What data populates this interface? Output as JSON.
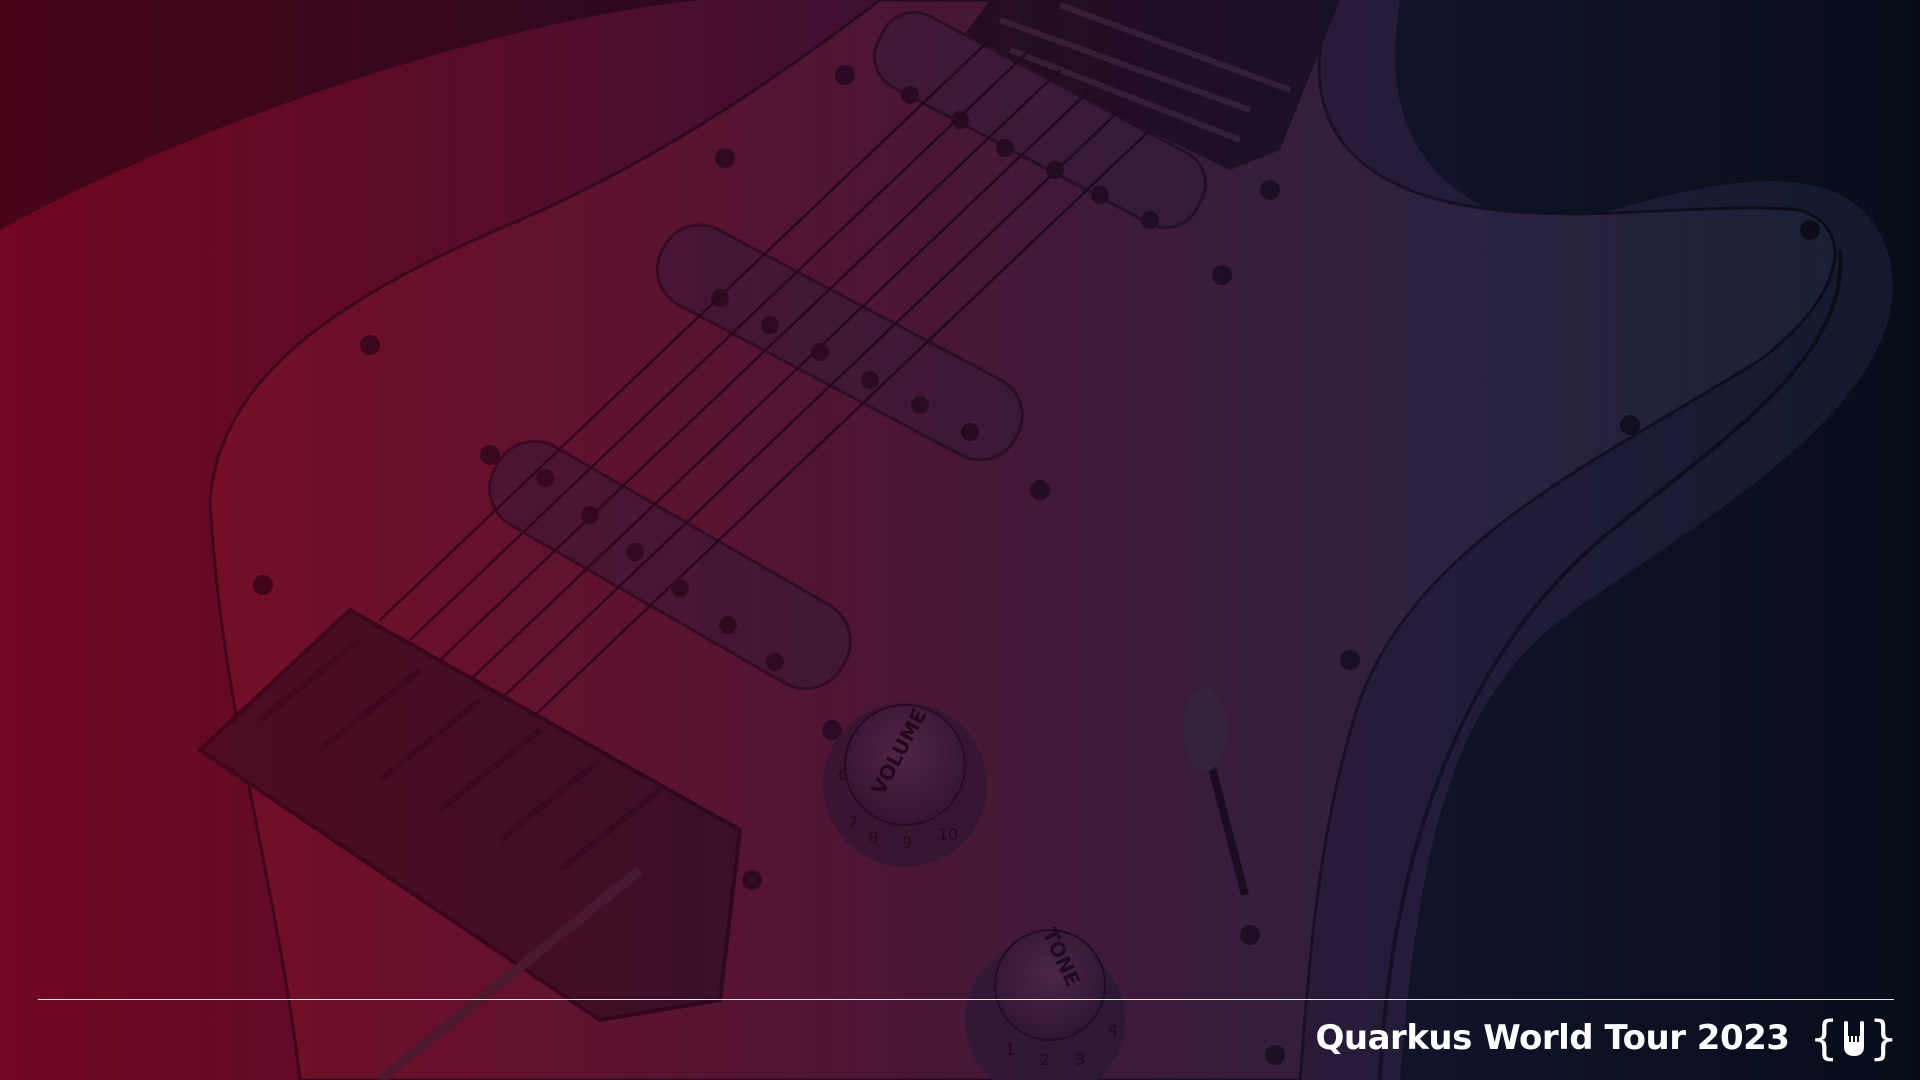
{
  "background": {
    "image": "electric-guitar-photo",
    "tint_left": "#7a0020",
    "tint_right": "#141a3a"
  },
  "footer": {
    "title": "Quarkus World Tour 2023",
    "logo_icon": "rock-hand-braces-icon",
    "logo_open": "{",
    "logo_close": "}"
  },
  "guitar": {
    "volume_label": "VOLUME",
    "tone_label": "TONE",
    "volume_numbers": [
      "6",
      "7",
      "8",
      "9",
      "10"
    ],
    "tone_numbers": [
      "1",
      "2",
      "3",
      "4"
    ]
  }
}
